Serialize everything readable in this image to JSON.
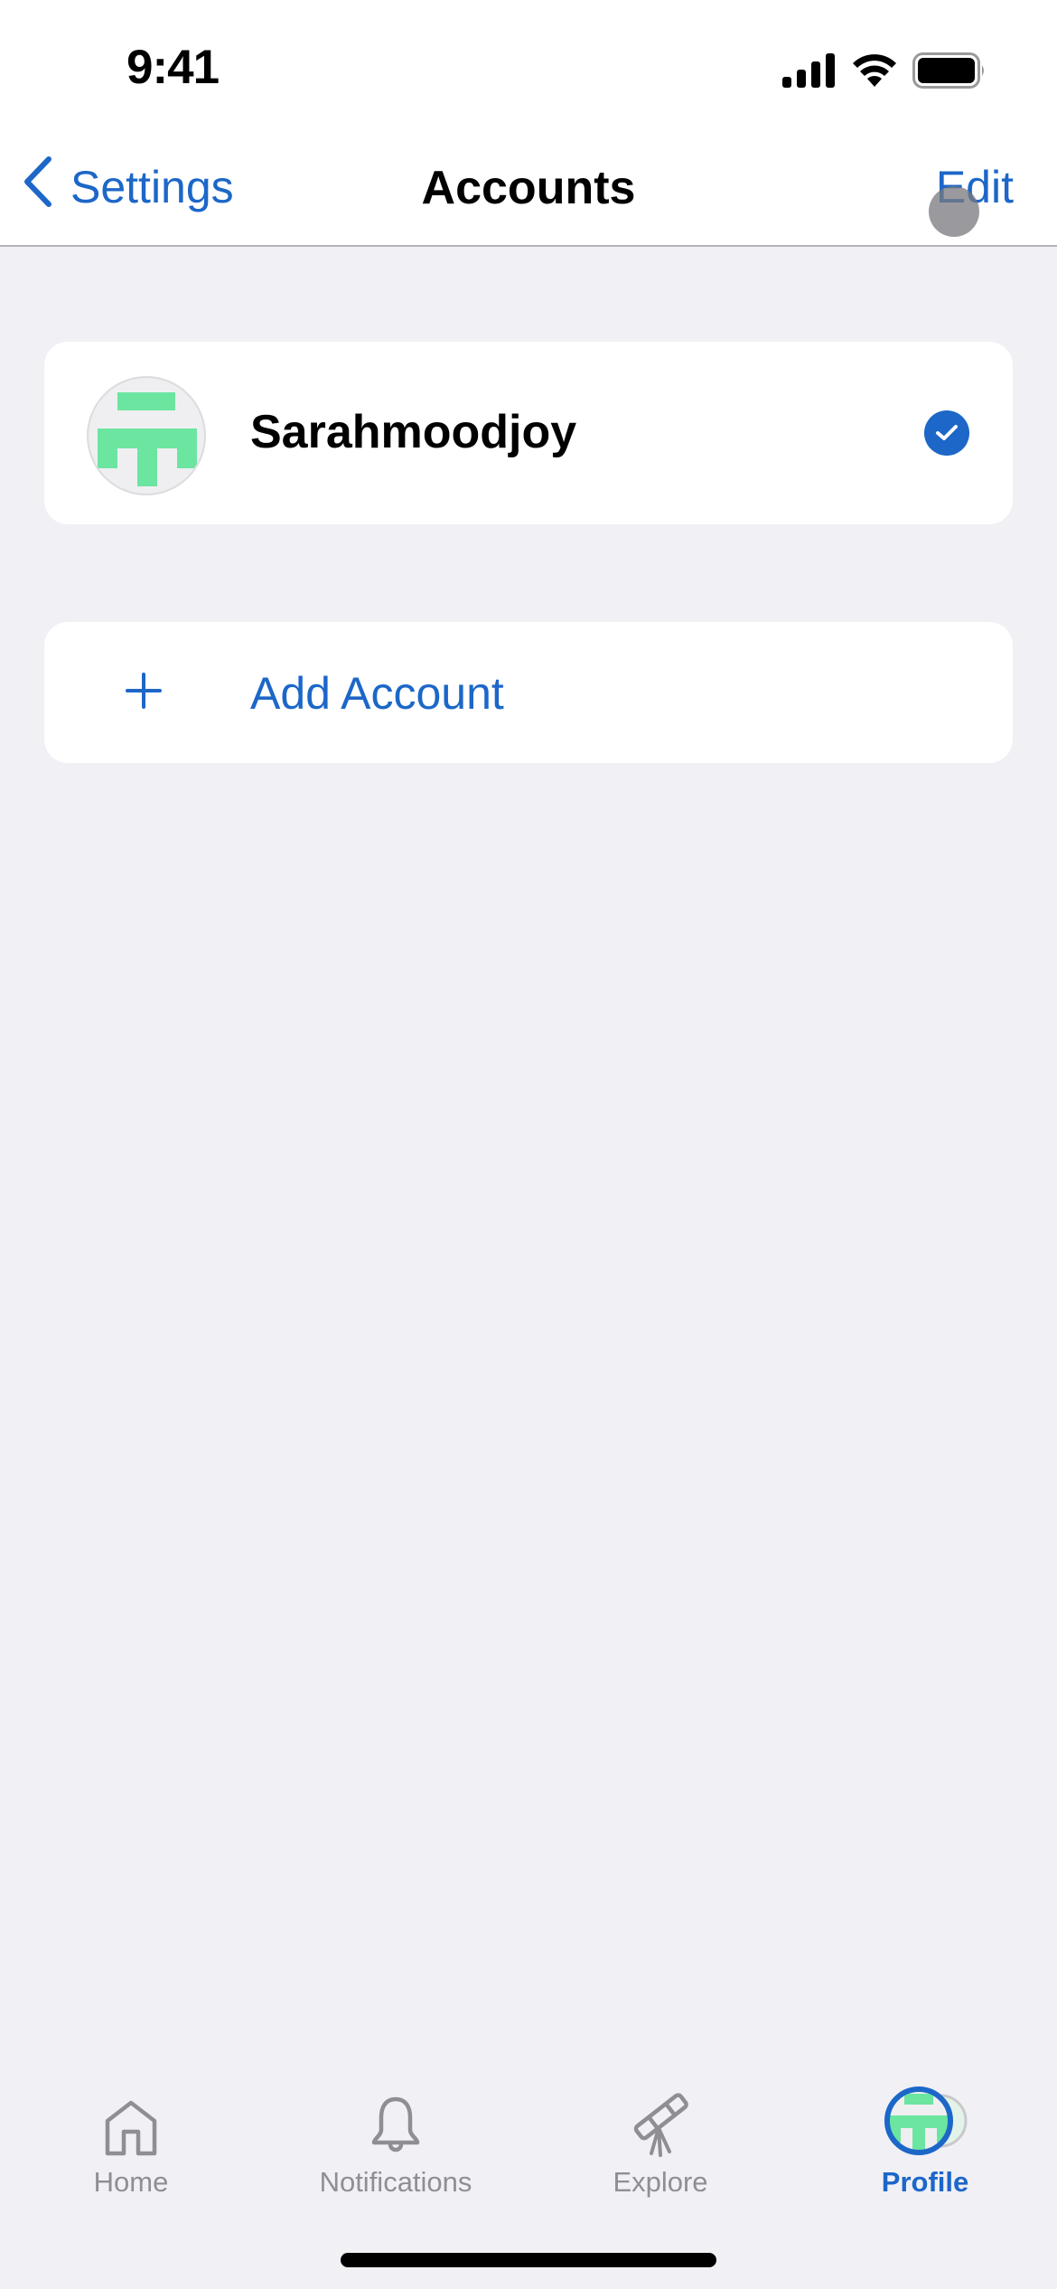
{
  "status_bar": {
    "time": "9:41",
    "icons": [
      "cellular-signal-icon",
      "wifi-icon",
      "battery-icon"
    ]
  },
  "nav": {
    "back_label": "Settings",
    "back_icon": "chevron-left-icon",
    "title": "Accounts",
    "edit_label": "Edit"
  },
  "accounts": [
    {
      "name": "Sarahmoodjoy",
      "selected": true,
      "avatar_icon": "pixel-identicon",
      "avatar_color": "#6ce5a0"
    }
  ],
  "add_account": {
    "icon": "plus-icon",
    "label": "Add Account"
  },
  "tab_bar": {
    "tabs": [
      {
        "label": "Home",
        "icon": "house-icon",
        "active": false
      },
      {
        "label": "Notifications",
        "icon": "bell-icon",
        "active": false
      },
      {
        "label": "Explore",
        "icon": "telescope-icon",
        "active": false
      },
      {
        "label": "Profile",
        "icon": "avatar-icon",
        "active": true
      }
    ]
  },
  "colors": {
    "accent": "#1c67c8",
    "background": "#f0f0f5",
    "inactive_tab": "#8e8e93",
    "identicon": "#6ce5a0"
  }
}
